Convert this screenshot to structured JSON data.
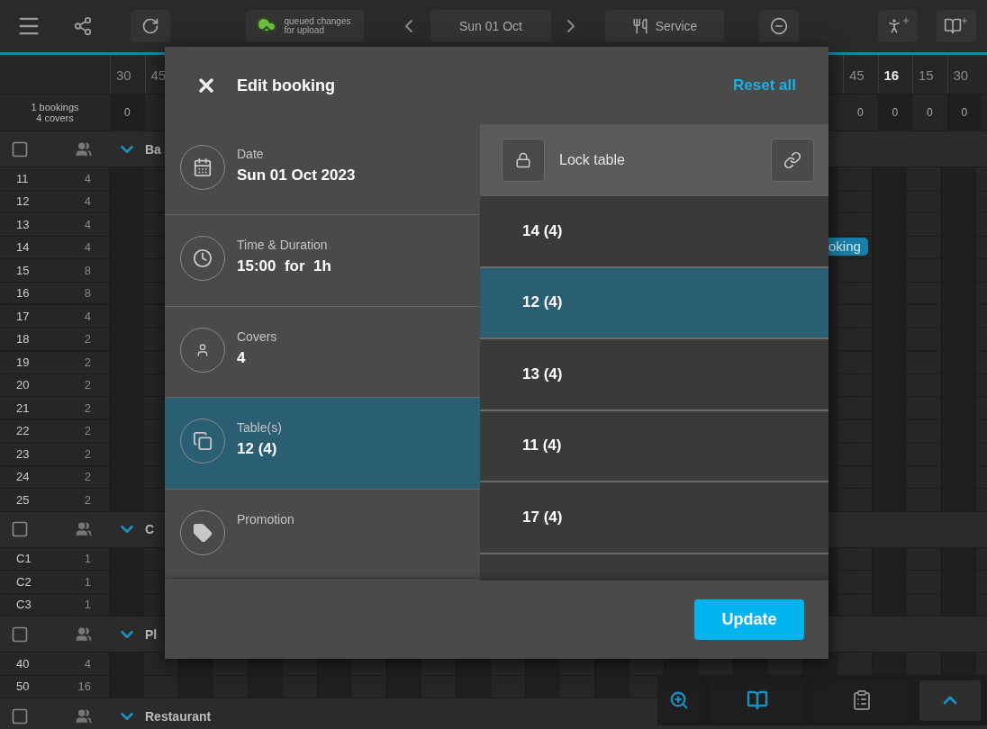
{
  "topbar": {
    "queued_label": "queued changes for upload",
    "date": "Sun 01 Oct",
    "service": "Service"
  },
  "timeline": {
    "left_labels": [
      {
        "text": "30",
        "major": false
      },
      {
        "text": "45",
        "major": false
      }
    ],
    "right_labels": [
      {
        "text": "45",
        "major": false
      },
      {
        "text": "16",
        "major": true
      },
      {
        "text": "15",
        "major": false
      },
      {
        "text": "30",
        "major": false
      }
    ],
    "summary": [
      "1 bookings",
      "4 covers"
    ],
    "left_counts": [
      "0"
    ],
    "right_counts": [
      "0",
      "0",
      "0",
      "0"
    ]
  },
  "sections": [
    {
      "name": "Ba",
      "rows": [
        {
          "table": "11",
          "covers": "4"
        },
        {
          "table": "12",
          "covers": "4"
        },
        {
          "table": "13",
          "covers": "4"
        },
        {
          "table": "14",
          "covers": "4",
          "booking": "oking"
        },
        {
          "table": "15",
          "covers": "8"
        },
        {
          "table": "16",
          "covers": "8"
        },
        {
          "table": "17",
          "covers": "4"
        },
        {
          "table": "18",
          "covers": "2"
        },
        {
          "table": "19",
          "covers": "2"
        },
        {
          "table": "20",
          "covers": "2"
        },
        {
          "table": "21",
          "covers": "2"
        },
        {
          "table": "22",
          "covers": "2"
        },
        {
          "table": "23",
          "covers": "2"
        },
        {
          "table": "24",
          "covers": "2"
        },
        {
          "table": "25",
          "covers": "2"
        }
      ]
    },
    {
      "name": "C",
      "rows": [
        {
          "table": "C1",
          "covers": "1"
        },
        {
          "table": "C2",
          "covers": "1"
        },
        {
          "table": "C3",
          "covers": "1"
        }
      ]
    },
    {
      "name": "Pl",
      "rows": [
        {
          "table": "40",
          "covers": "4"
        },
        {
          "table": "50",
          "covers": "16"
        }
      ]
    },
    {
      "name": "Restaurant"
    }
  ],
  "modal": {
    "title": "Edit booking",
    "reset": "Reset all",
    "fields": [
      {
        "kind": "date",
        "label": "Date",
        "value": "Sun 01 Oct 2023",
        "selected": false
      },
      {
        "kind": "time",
        "label": "Time & Duration",
        "value": "15:00  for  1h",
        "selected": false
      },
      {
        "kind": "covers",
        "label": "Covers",
        "value": "4",
        "selected": false
      },
      {
        "kind": "tables",
        "label": "Table(s)",
        "value": "12 (4)",
        "selected": true
      },
      {
        "kind": "promotion",
        "label": "Promotion",
        "selected": false
      }
    ],
    "lock_label": "Lock table",
    "tables": [
      {
        "label": "14 (4)",
        "selected": false
      },
      {
        "label": "12 (4)",
        "selected": true
      },
      {
        "label": "13 (4)",
        "selected": false
      },
      {
        "label": "11 (4)",
        "selected": false
      },
      {
        "label": "17 (4)",
        "selected": false
      }
    ],
    "update": "Update"
  }
}
